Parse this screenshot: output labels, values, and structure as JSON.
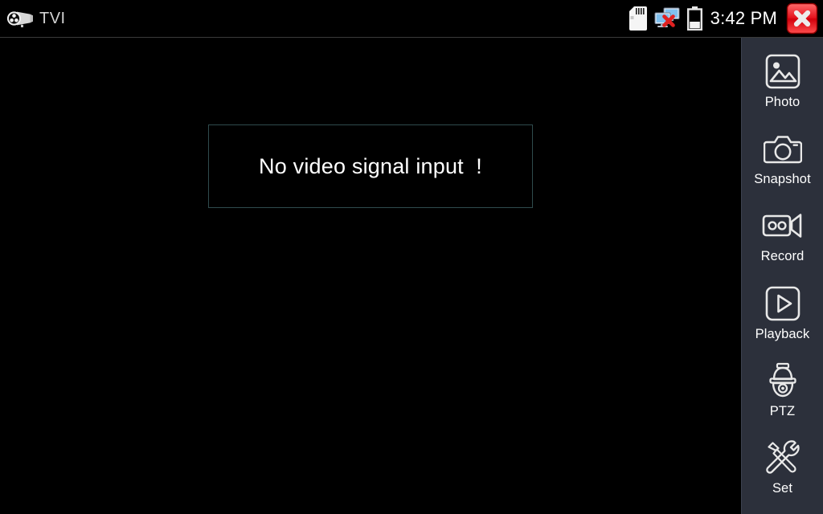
{
  "status_bar": {
    "app_icon": "cctv-bullet-camera-icon",
    "app_title": "TVI",
    "icons": [
      {
        "name": "sd-card-icon",
        "label": "SD card"
      },
      {
        "name": "network-disconnected-icon",
        "label": "Network disconnected"
      },
      {
        "name": "battery-icon",
        "label": "Battery"
      }
    ],
    "time": "3:42 PM",
    "close_button": {
      "name": "close-button",
      "glyph": "✕",
      "color": "#e81123"
    }
  },
  "video": {
    "no_signal_message": "No video signal input  !",
    "border_color": "#2f4b4d",
    "background_color": "#000000"
  },
  "sidebar": {
    "background_color": "#2c303b",
    "items": [
      {
        "label": "Photo",
        "icon": "photo-icon"
      },
      {
        "label": "Snapshot",
        "icon": "snapshot-camera-icon"
      },
      {
        "label": "Record",
        "icon": "record-video-camera-icon"
      },
      {
        "label": "Playback",
        "icon": "playback-play-icon"
      },
      {
        "label": "PTZ",
        "icon": "ptz-dome-camera-icon"
      },
      {
        "label": "Set",
        "icon": "settings-tools-icon"
      }
    ]
  }
}
